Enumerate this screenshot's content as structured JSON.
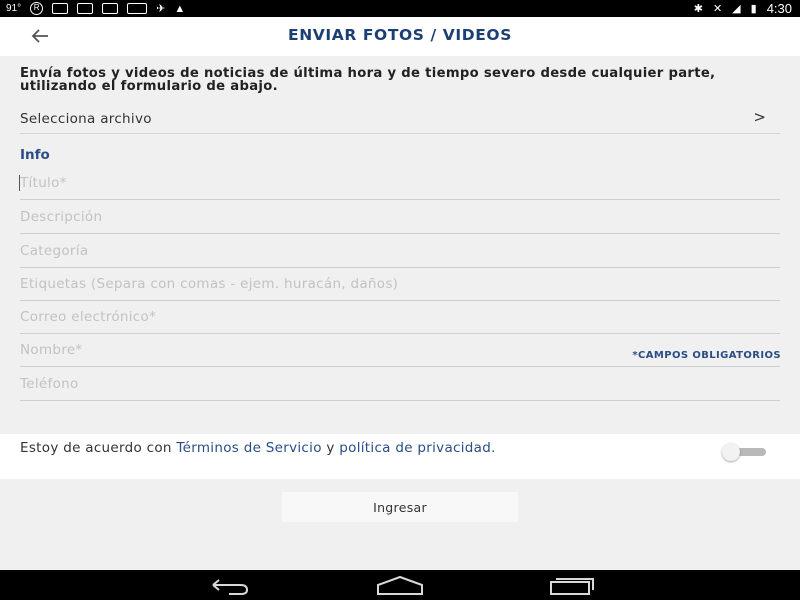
{
  "status_bar": {
    "temperature": "91°",
    "time": "4:30",
    "icons": [
      "registered-icon",
      "download-icon",
      "news-icon",
      "card-icon",
      "barcode-icon",
      "plane-icon",
      "warning-icon",
      "bluetooth-icon",
      "mute-icon",
      "wifi-icon",
      "battery-icon"
    ]
  },
  "header": {
    "back_icon": "arrow-left-icon",
    "title": "ENVIAR FOTOS / VIDEOS"
  },
  "intro_text": "Envía fotos y videos de noticias de última hora y de tiempo severo desde cualquier parte, utilizando el formulario de abajo.",
  "file_select": {
    "label": "Selecciona archivo",
    "chevron": ">"
  },
  "info_label": "Info",
  "fields": {
    "title": {
      "value": "",
      "placeholder": "Título*"
    },
    "description": {
      "value": "",
      "placeholder": "Descripción"
    },
    "category": {
      "value": "",
      "placeholder": "Categoría"
    },
    "tags": {
      "value": "",
      "placeholder": "Etiquetas (Separa con comas - ejem. huracán, daños)"
    },
    "email": {
      "value": "",
      "placeholder": "Correo electrónico*"
    },
    "name": {
      "value": "",
      "placeholder": "Nombre*"
    },
    "phone": {
      "value": "",
      "placeholder": "Teléfono"
    }
  },
  "required_note": "*CAMPOS OBLIGATORIOS",
  "terms": {
    "prefix": "Estoy de acuerdo con ",
    "terms_link": "Términos de Servicio",
    "middle": " y ",
    "privacy_link": "política de privacidad",
    "suffix": ".",
    "toggle_on": false
  },
  "submit_label": "Ingresar",
  "nav_bar": {
    "buttons": [
      "back-nav-icon",
      "home-nav-icon",
      "recents-nav-icon"
    ]
  },
  "colors": {
    "accent": "#2a4d86",
    "title": "#1c3f73",
    "background": "#f0f0f0"
  }
}
